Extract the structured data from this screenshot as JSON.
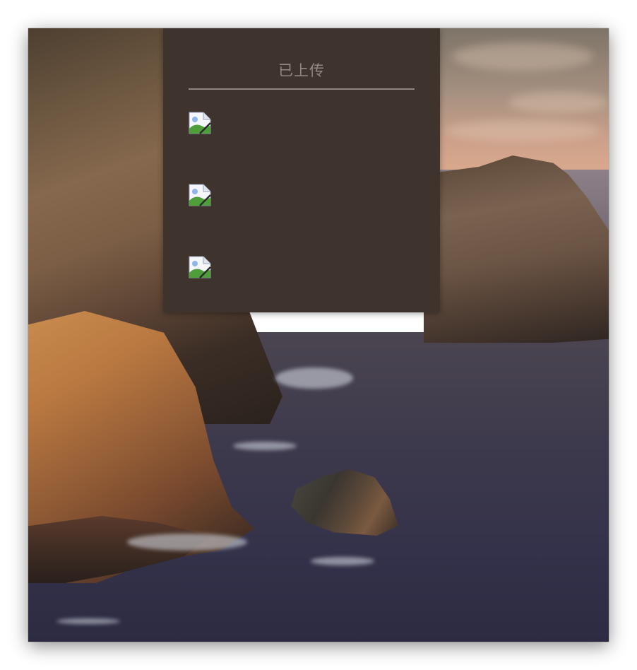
{
  "panel": {
    "title": "已上传",
    "items": [
      {
        "icon": "broken-image-icon"
      },
      {
        "icon": "broken-image-icon"
      },
      {
        "icon": "broken-image-icon"
      }
    ]
  },
  "colors": {
    "panel_bg": "#3f342d",
    "title_text": "#8f8883",
    "divider": "#8d8681"
  }
}
